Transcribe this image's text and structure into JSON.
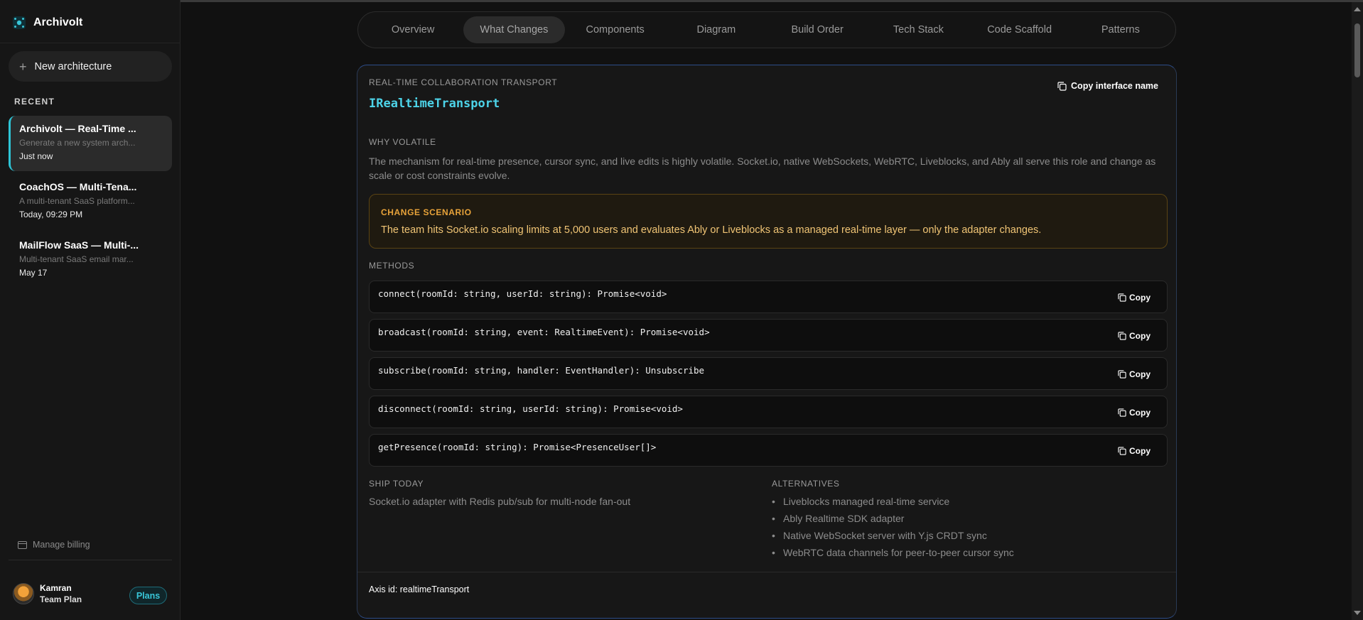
{
  "app": {
    "name": "Archivolt"
  },
  "sidebar": {
    "new_button": "New architecture",
    "recent_heading": "RECENT",
    "recent": [
      {
        "title": "Archivolt — Real-Time ...",
        "subtitle": "Generate a new system arch...",
        "time": "Just now"
      },
      {
        "title": "CoachOS — Multi-Tena...",
        "subtitle": "A multi-tenant SaaS platform...",
        "time": "Today, 09:29 PM"
      },
      {
        "title": "MailFlow SaaS — Multi-...",
        "subtitle": "Multi-tenant SaaS email mar...",
        "time": "May 17"
      }
    ],
    "manage_billing": "Manage billing",
    "user": {
      "name": "Kamran",
      "plan": "Team Plan"
    },
    "plans_button": "Plans"
  },
  "tabs": [
    "Overview",
    "What Changes",
    "Components",
    "Diagram",
    "Build Order",
    "Tech Stack",
    "Code Scaffold",
    "Patterns"
  ],
  "active_tab": "What Changes",
  "card": {
    "section_label": "REAL-TIME COLLABORATION TRANSPORT",
    "interface_name": "IRealtimeTransport",
    "copy_interface": "Copy interface name",
    "why_volatile_label": "WHY VOLATILE",
    "why_volatile_text": "The mechanism for real-time presence, cursor sync, and live edits is highly volatile. Socket.io, native WebSockets, WebRTC, Liveblocks, and Ably all serve this role and change as scale or cost constraints evolve.",
    "change_scenario_label": "CHANGE SCENARIO",
    "change_scenario_text": "The team hits Socket.io scaling limits at 5,000 users and evaluates Ably or Liveblocks as a managed real-time layer — only the adapter changes.",
    "methods_label": "METHODS",
    "methods": [
      "connect(roomId: string, userId: string): Promise<void>",
      "broadcast(roomId: string, event: RealtimeEvent): Promise<void>",
      "subscribe(roomId: string, handler: EventHandler): Unsubscribe",
      "disconnect(roomId: string, userId: string): Promise<void>",
      "getPresence(roomId: string): Promise<PresenceUser[]>"
    ],
    "copy_label": "Copy",
    "ship_today_label": "SHIP TODAY",
    "ship_today_text": "Socket.io adapter with Redis pub/sub for multi-node fan-out",
    "alternatives_label": "ALTERNATIVES",
    "alternatives": [
      "Liveblocks managed real-time service",
      "Ably Realtime SDK adapter",
      "Native WebSocket server with Y.js CRDT sync",
      "WebRTC data channels for peer-to-peer cursor sync"
    ],
    "axis_id": "Axis id: realtimeTransport"
  },
  "colors": {
    "accent": "#4dd3e8",
    "scenario": "#e8a33a",
    "background": "#111111"
  }
}
